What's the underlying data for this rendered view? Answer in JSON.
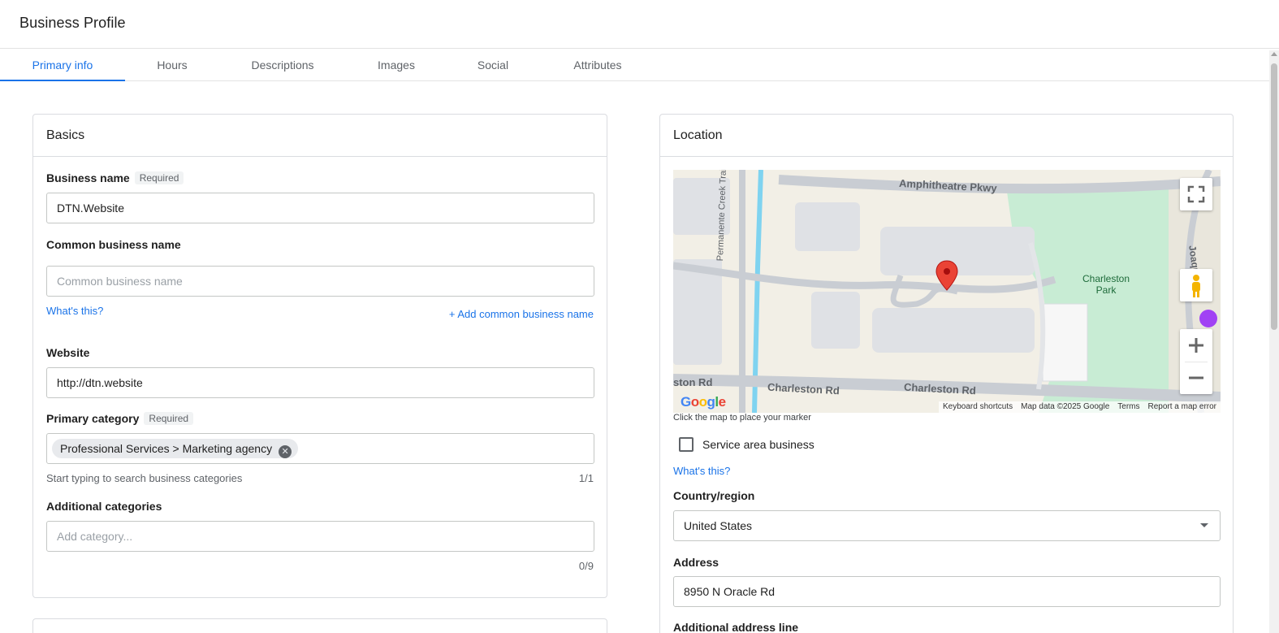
{
  "header": {
    "title": "Business Profile"
  },
  "tabs": [
    {
      "label": "Primary info",
      "active": true
    },
    {
      "label": "Hours",
      "active": false
    },
    {
      "label": "Descriptions",
      "active": false
    },
    {
      "label": "Images",
      "active": false
    },
    {
      "label": "Social",
      "active": false
    },
    {
      "label": "Attributes",
      "active": false
    }
  ],
  "basics": {
    "title": "Basics",
    "business_name": {
      "label": "Business name",
      "badge": "Required",
      "value": "DTN.Website"
    },
    "common_name": {
      "label": "Common business name",
      "placeholder": "Common business name",
      "whats_this": "What's this?",
      "add_link": "+ Add common business name"
    },
    "website": {
      "label": "Website",
      "value": "http://dtn.website"
    },
    "primary_category": {
      "label": "Primary category",
      "badge": "Required",
      "chip": "Professional Services > Marketing agency",
      "hint": "Start typing to search business categories",
      "count": "1/1"
    },
    "additional_categories": {
      "label": "Additional categories",
      "placeholder": "Add category...",
      "count": "0/9"
    }
  },
  "location": {
    "title": "Location",
    "map": {
      "roads": [
        "Amphitheatre Pkwy",
        "Permanente Creek Trail",
        "Charleston Rd",
        "Charleston Rd",
        "ston Rd",
        "Joaquin Rd"
      ],
      "park": "Charleston Park",
      "logo": "Google",
      "footer": [
        "Keyboard shortcuts",
        "Map data ©2025 Google",
        "Terms",
        "Report a map error"
      ],
      "controls": [
        "fullscreen-icon",
        "pegman-icon",
        "zoom-in-icon",
        "zoom-out-icon"
      ]
    },
    "map_hint": "Click the map to place your marker",
    "service_area": {
      "label": "Service area business",
      "checked": false
    },
    "whats_this": "What's this?",
    "country": {
      "label": "Country/region",
      "value": "United States"
    },
    "address": {
      "label": "Address",
      "value": "8950 N Oracle Rd"
    },
    "address2": {
      "label": "Additional address line"
    }
  },
  "colors": {
    "accent": "#1a73e8",
    "marker": "#ea4335",
    "park": "#c8ecd4"
  }
}
